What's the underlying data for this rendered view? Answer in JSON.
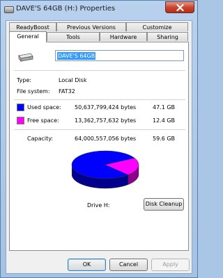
{
  "window": {
    "title": "DAVE'S 64GB (H:) Properties"
  },
  "tabs_back": [
    "ReadyBoost",
    "Previous Versions",
    "Customize"
  ],
  "tabs_front": [
    "General",
    "Tools",
    "Hardware",
    "Sharing"
  ],
  "general": {
    "drive_name": "DAVE'S 64GB",
    "type_label": "Type:",
    "type_value": "Local Disk",
    "fs_label": "File system:",
    "fs_value": "FAT32",
    "used": {
      "label": "Used space:",
      "bytes": "50,637,799,424 bytes",
      "size": "47.1 GB",
      "color": "#0000ff"
    },
    "free": {
      "label": "Free space:",
      "bytes": "13,362,757,632 bytes",
      "size": "12.4 GB",
      "color": "#ff00ff"
    },
    "capacity": {
      "label": "Capacity:",
      "bytes": "64,000,557,056 bytes",
      "size": "59.6 GB"
    },
    "drive_label": "Drive H:",
    "cleanup_button": "Disk Cleanup"
  },
  "chart_data": {
    "type": "pie",
    "slices": [
      {
        "label": "Used space",
        "value": 47.1,
        "color": "#0000ff"
      },
      {
        "label": "Free space",
        "value": 12.4,
        "color": "#ff00ff"
      }
    ]
  },
  "buttons": {
    "ok": "OK",
    "cancel": "Cancel",
    "apply": "Apply"
  }
}
